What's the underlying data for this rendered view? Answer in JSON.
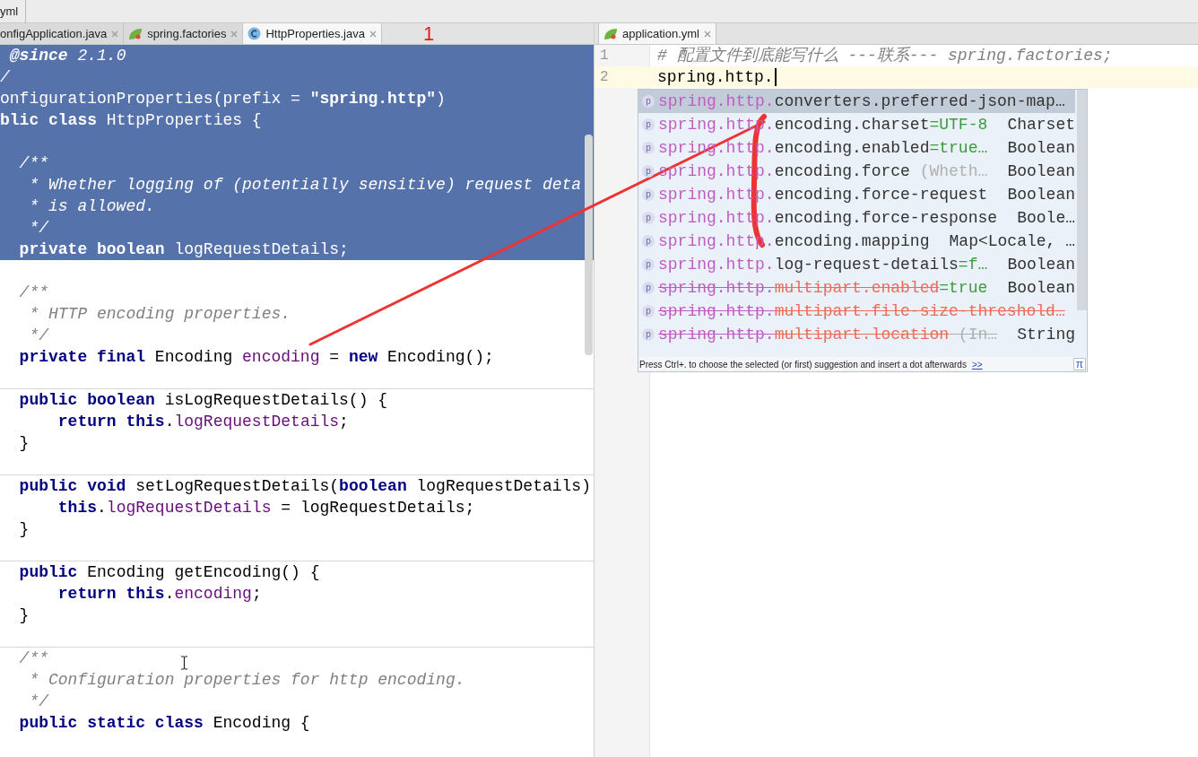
{
  "breadcrumb": {
    "label": "yml"
  },
  "left_tabs": [
    {
      "label": "onfigApplication.java",
      "kind": "plain",
      "selected": false
    },
    {
      "label": "spring.factories",
      "kind": "spring",
      "selected": false
    },
    {
      "label": "HttpProperties.java",
      "kind": "class",
      "selected": true
    }
  ],
  "annotation_label": "1",
  "left_code": [
    {
      "selected": true,
      "tokens": [
        {
          "text": " @since",
          "kind": "doctag"
        },
        {
          "text": " 2.1.0",
          "kind": "comment"
        }
      ]
    },
    {
      "selected": true,
      "tokens": [
        {
          "text": "/",
          "kind": "comment"
        }
      ]
    },
    {
      "selected": true,
      "tokens": [
        {
          "text": "onfigurationProperties(prefix = ",
          "kind": "plain"
        },
        {
          "text": "\"spring.http\"",
          "kind": "string"
        },
        {
          "text": ")",
          "kind": "plain"
        }
      ]
    },
    {
      "selected": true,
      "tokens": [
        {
          "text": "blic class",
          "kind": "keyword"
        },
        {
          "text": " HttpProperties {",
          "kind": "plain"
        }
      ]
    },
    {
      "selected": true
    },
    {
      "selected": true,
      "tokens": [
        {
          "text": "  /**",
          "kind": "comment"
        }
      ]
    },
    {
      "selected": true,
      "tokens": [
        {
          "text": "   * Whether logging of (potentially sensitive) request deta",
          "kind": "comment"
        }
      ]
    },
    {
      "selected": true,
      "tokens": [
        {
          "text": "   * is allowed.",
          "kind": "comment"
        }
      ]
    },
    {
      "selected": true,
      "tokens": [
        {
          "text": "   */",
          "kind": "comment"
        }
      ]
    },
    {
      "selected": true,
      "tokens": [
        {
          "text": "  private boolean",
          "kind": "keyword"
        },
        {
          "text": " logRequestDetails;",
          "kind": "plain"
        }
      ]
    },
    {
      "selected": false
    },
    {
      "selected": false,
      "tokens": [
        {
          "text": "  /**",
          "kind": "comment"
        }
      ]
    },
    {
      "selected": false,
      "tokens": [
        {
          "text": "   * HTTP encoding properties.",
          "kind": "comment"
        }
      ]
    },
    {
      "selected": false,
      "tokens": [
        {
          "text": "   */",
          "kind": "comment"
        }
      ]
    },
    {
      "selected": false,
      "tokens": [
        {
          "text": "  private final",
          "kind": "keyword"
        },
        {
          "text": " Encoding ",
          "kind": "plain"
        },
        {
          "text": "encoding",
          "kind": "field"
        },
        {
          "text": " = ",
          "kind": "plain"
        },
        {
          "text": "new",
          "kind": "keyword"
        },
        {
          "text": " Encoding();",
          "kind": "plain"
        }
      ]
    },
    {
      "selected": false,
      "separator": true
    },
    {
      "selected": false,
      "tokens": [
        {
          "text": "  public boolean",
          "kind": "keyword"
        },
        {
          "text": " isLogRequestDetails() {",
          "kind": "plain"
        }
      ]
    },
    {
      "selected": false,
      "tokens": [
        {
          "text": "      return this",
          "kind": "keyword"
        },
        {
          "text": ".",
          "kind": "plain"
        },
        {
          "text": "logRequestDetails",
          "kind": "field"
        },
        {
          "text": ";",
          "kind": "plain"
        }
      ]
    },
    {
      "selected": false,
      "tokens": [
        {
          "text": "  }",
          "kind": "plain"
        }
      ]
    },
    {
      "selected": false,
      "separator": true
    },
    {
      "selected": false,
      "tokens": [
        {
          "text": "  public void",
          "kind": "keyword"
        },
        {
          "text": " setLogRequestDetails(",
          "kind": "plain"
        },
        {
          "text": "boolean",
          "kind": "keyword"
        },
        {
          "text": " logRequestDetails)",
          "kind": "plain"
        }
      ]
    },
    {
      "selected": false,
      "tokens": [
        {
          "text": "      this",
          "kind": "keyword"
        },
        {
          "text": ".",
          "kind": "plain"
        },
        {
          "text": "logRequestDetails",
          "kind": "field"
        },
        {
          "text": " = logRequestDetails;",
          "kind": "plain"
        }
      ]
    },
    {
      "selected": false,
      "tokens": [
        {
          "text": "  }",
          "kind": "plain"
        }
      ]
    },
    {
      "selected": false,
      "separator": true
    },
    {
      "selected": false,
      "tokens": [
        {
          "text": "  public",
          "kind": "keyword"
        },
        {
          "text": " Encoding getEncoding() {",
          "kind": "plain"
        }
      ]
    },
    {
      "selected": false,
      "tokens": [
        {
          "text": "      return this",
          "kind": "keyword"
        },
        {
          "text": ".",
          "kind": "plain"
        },
        {
          "text": "encoding",
          "kind": "field"
        },
        {
          "text": ";",
          "kind": "plain"
        }
      ]
    },
    {
      "selected": false,
      "tokens": [
        {
          "text": "  }",
          "kind": "plain"
        }
      ]
    },
    {
      "selected": false,
      "separator": true
    },
    {
      "selected": false,
      "tokens": [
        {
          "text": "  /**",
          "kind": "comment"
        }
      ]
    },
    {
      "selected": false,
      "tokens": [
        {
          "text": "   * Configuration properties for http encoding.",
          "kind": "comment"
        }
      ]
    },
    {
      "selected": false,
      "tokens": [
        {
          "text": "   */",
          "kind": "comment"
        }
      ]
    },
    {
      "selected": false,
      "tokens": [
        {
          "text": "  public static class",
          "kind": "keyword"
        },
        {
          "text": " Encoding {",
          "kind": "plain"
        }
      ]
    },
    {
      "selected": false
    }
  ],
  "right_tab": {
    "label": "application.yml",
    "selected": true
  },
  "right_code": [
    {
      "number": "1",
      "current": false,
      "text": "# 配置文件到底能写什么 ---联系--- spring.factories;",
      "kind": "comment"
    },
    {
      "number": "2",
      "current": true,
      "text": "spring.http.",
      "kind": "plain"
    }
  ],
  "completion": {
    "items": [
      {
        "badge": "p",
        "prefix": "spring.http.",
        "name": "converters.preferred-json-map…",
        "selected": true,
        "deprecated": false
      },
      {
        "badge": "p",
        "prefix": "spring.http.",
        "name": "encoding.charset",
        "value": "=UTF-8",
        "type": "Charset",
        "selected": false,
        "deprecated": false
      },
      {
        "badge": "p",
        "prefix": "spring.http.",
        "name": "encoding.enabled",
        "value": "=true…",
        "type": "Boolean",
        "selected": false,
        "deprecated": false
      },
      {
        "badge": "p",
        "prefix": "spring.http.",
        "name": "encoding.force",
        "hint": "(Wheth…",
        "type": "Boolean",
        "selected": false,
        "deprecated": false
      },
      {
        "badge": "p",
        "prefix": "spring.http.",
        "name": "encoding.force-request",
        "type": "Boolean",
        "selected": false,
        "deprecated": false
      },
      {
        "badge": "p",
        "prefix": "spring.http.",
        "name": "encoding.force-response",
        "type": "Boole…",
        "selected": false,
        "deprecated": false
      },
      {
        "badge": "p",
        "prefix": "spring.http.",
        "name": "encoding.mapping",
        "type": "Map<Locale, …",
        "selected": false,
        "deprecated": false
      },
      {
        "badge": "p",
        "prefix": "spring.http.",
        "name": "log-request-details",
        "value": "=f…",
        "type": "Boolean",
        "selected": false,
        "deprecated": false
      },
      {
        "badge": "p",
        "prefix": "spring.http.",
        "name": "multipart.enabled",
        "value": "=true",
        "type": "Boolean",
        "selected": false,
        "deprecated": true
      },
      {
        "badge": "p",
        "prefix": "spring.http.",
        "name": "multipart.file-size-threshold…",
        "selected": false,
        "deprecated": true
      },
      {
        "badge": "p",
        "prefix": "spring.http.",
        "name": "multipart.location",
        "hint": "(In…",
        "type": "String",
        "selected": false,
        "deprecated": true
      }
    ],
    "footer": "Press Ctrl+. to choose the selected (or first) suggestion and insert a dot afterwards",
    "footer_link": ">>",
    "corner_symbol": "π"
  }
}
